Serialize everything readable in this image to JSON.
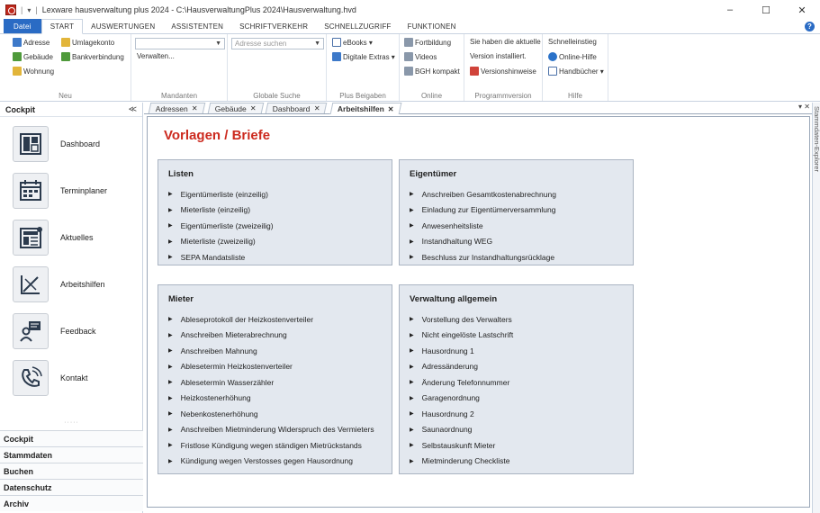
{
  "window": {
    "title": "Lexware hausverwaltung plus 2024 - C:\\HausverwaltungPlus 2024\\Hausverwaltung.hvd",
    "minimize": "–",
    "maximize": "☐",
    "close": "✕"
  },
  "ribbon_tabs": [
    "Datei",
    "START",
    "AUSWERTUNGEN",
    "ASSISTENTEN",
    "SCHRIFTVERKEHR",
    "SCHNELLZUGRIFF",
    "FUNKTIONEN"
  ],
  "ribbon": {
    "neu": {
      "label": "Neu",
      "adresse": "Adresse",
      "umlagekonto": "Umlagekonto",
      "gebaeude": "Gebäude",
      "bankverbindung": "Bankverbindung",
      "wohnung": "Wohnung"
    },
    "mandanten": {
      "label": "Mandanten",
      "combo_value": "",
      "verwalten": "Verwalten..."
    },
    "suche": {
      "label": "Globale Suche",
      "placeholder": "Adresse suchen"
    },
    "beigaben": {
      "label": "Plus Beigaben",
      "ebooks": "eBooks ▾",
      "extras": "Digitale Extras ▾"
    },
    "online": {
      "label": "Online",
      "fortbildung": "Fortbildung",
      "videos": "Videos",
      "bgh": "BGH kompakt"
    },
    "programmversion": {
      "label": "Programmversion",
      "line1": "Sie haben die aktuelle",
      "line2": "Version installiert.",
      "versionshinweise": "Versionshinweise"
    },
    "hilfe": {
      "label": "Hilfe",
      "schnelleinstieg": "Schnelleinstieg",
      "online_hilfe": "Online-Hilfe",
      "handbuecher": "Handbücher ▾"
    }
  },
  "left_panel": {
    "header": "Cockpit",
    "collapse": "≪",
    "items": [
      "Dashboard",
      "Terminplaner",
      "Aktuelles",
      "Arbeitshilfen",
      "Feedback",
      "Kontakt"
    ],
    "grip": "·····",
    "nav": [
      "Cockpit",
      "Stammdaten",
      "Buchen",
      "Datenschutz",
      "Archiv"
    ]
  },
  "doc_tabs": [
    {
      "label": "Adressen",
      "close": "✕"
    },
    {
      "label": "Gebäude",
      "close": "✕"
    },
    {
      "label": "Dashboard",
      "close": "✕"
    },
    {
      "label": "Arbeitshilfen",
      "close": "✕"
    }
  ],
  "doc_tab_controls": "▾ ✕",
  "right_strip": "Stammdaten-Explorer",
  "content": {
    "title": "Vorlagen / Briefe",
    "cards": [
      {
        "title": "Listen",
        "items": [
          "Eigentümerliste (einzeilig)",
          "Mieterliste (einzeilig)",
          "Eigentümerliste (zweizeilig)",
          "Mieterliste (zweizeilig)",
          "SEPA Mandatsliste"
        ]
      },
      {
        "title": "Eigentümer",
        "items": [
          "Anschreiben Gesamtkostenabrechnung",
          "Einladung zur Eigentümerversammlung",
          "Anwesenheitsliste",
          "Instandhaltung WEG",
          "Beschluss zur Instandhaltungsrücklage"
        ]
      },
      {
        "title": "Mieter",
        "items": [
          "Ableseprotokoll der Heizkostenverteiler",
          "Anschreiben Mieterabrechnung",
          "Anschreiben Mahnung",
          "Ablesetermin Heizkostenverteiler",
          "Ablesetermin Wasserzähler",
          "Heizkostenerhöhung",
          "Nebenkostenerhöhung",
          "Anschreiben Mietminderung Widerspruch des Vermieters",
          "Fristlose Kündigung wegen ständigen Mietrückstands",
          "Kündigung wegen Verstosses gegen Hausordnung"
        ]
      },
      {
        "title": "Verwaltung allgemein",
        "items": [
          "Vorstellung des Verwalters",
          "Nicht eingelöste Lastschrift",
          "Hausordnung 1",
          "Adressänderung",
          "Änderung Telefonnummer",
          "Garagenordnung",
          "Hausordnung 2",
          "Saunaordnung",
          "Selbstauskunft Mieter",
          "Mietminderung Checkliste"
        ]
      }
    ]
  },
  "colors": {
    "accent": "#2a6bc4",
    "title_red": "#cc2a1f",
    "card_bg": "#e3e8ef"
  }
}
